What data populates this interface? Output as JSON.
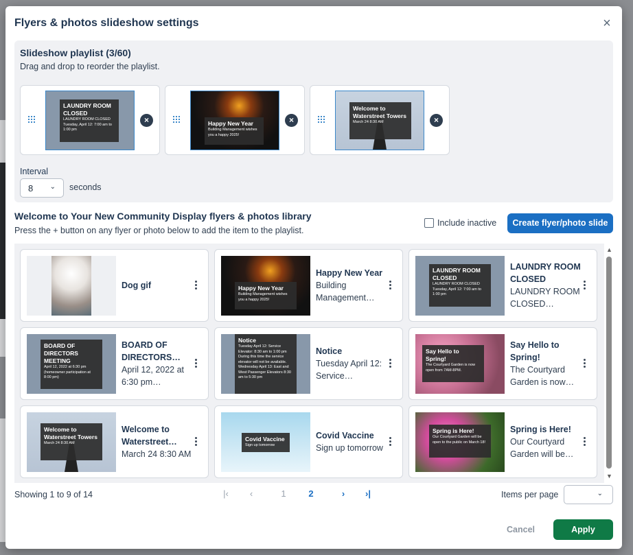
{
  "modal": {
    "title": "Flyers & photos slideshow settings"
  },
  "playlist": {
    "title": "Slideshow playlist (3/60)",
    "subtitle": "Drag and drop to reorder the playlist.",
    "items": [
      {
        "overlay_title": "LAUNDRY ROOM CLOSED",
        "overlay_text": "LAUNDRY ROOM CLOSED\nTuesday, April 12:\n7:00 am to 1:00 pm"
      },
      {
        "overlay_title": "Happy New Year",
        "overlay_text": "Building Management wishes you a happy 2025!"
      },
      {
        "overlay_title": "Welcome to Waterstreet Towers",
        "overlay_text": "March 24 8:30 AM"
      }
    ],
    "remove_icon": "×"
  },
  "interval": {
    "label": "Interval",
    "value": "8",
    "unit": "seconds"
  },
  "library": {
    "title": "Welcome to Your New Community Display flyers & photos library",
    "subtitle": "Press the + button on any flyer or photo below to add the item to the playlist.",
    "include_inactive": "Include inactive",
    "create_button": "Create flyer/photo slide"
  },
  "cards": [
    {
      "title": "Dog gif",
      "desc": "",
      "overlay_title": "",
      "overlay_text": ""
    },
    {
      "title": "Happy New Year",
      "desc": "Building Management…",
      "overlay_title": "Happy New Year",
      "overlay_text": "Building Management wishes you a happy 2025!"
    },
    {
      "title": "LAUNDRY ROOM CLOSED",
      "desc": "LAUNDRY ROOM CLOSED…",
      "overlay_title": "LAUNDRY ROOM CLOSED",
      "overlay_text": "LAUNDRY ROOM CLOSED\nTuesday, April 12:\n7:00 am to 1:00 pm"
    },
    {
      "title": "BOARD OF DIRECTORS…",
      "desc": "April 12, 2022 at 6:30 pm…",
      "overlay_title": "BOARD OF DIRECTORS MEETING",
      "overlay_text": "April 12, 2022 at 6:30 pm (homeowner participation at 8:00 pm)"
    },
    {
      "title": "Notice",
      "desc": "Tuesday April 12: Service…",
      "overlay_title": "Notice",
      "overlay_text": "Tuesday April 12: Service Elevator: 8:30 am to 1:00 pm During this time the service elevator will not be available. Wednesday April 13: East and West Passenger Elevators 8:30 am to 5:30 pm"
    },
    {
      "title": "Say Hello to Spring!",
      "desc": "The Courtyard Garden is now…",
      "overlay_title": "Say Hello to Spring!",
      "overlay_text": "The Courtyard Garden is now open from 7AM-8PM."
    },
    {
      "title": "Welcome to Waterstreet…",
      "desc": "March 24 8:30 AM",
      "overlay_title": "Welcome to Waterstreet Towers",
      "overlay_text": "March 24 8:30 AM"
    },
    {
      "title": "Covid Vaccine",
      "desc": "Sign up tomorrow",
      "overlay_title": "Covid Vaccine",
      "overlay_text": "Sign up tomorrow"
    },
    {
      "title": "Spring is Here!",
      "desc": "Our Courtyard Garden will be…",
      "overlay_title": "Spring is Here!",
      "overlay_text": "Our Courtyard Garden will be open to the public on March 18!"
    }
  ],
  "pagination": {
    "showing": "Showing 1 to 9 of 14",
    "first": "|‹",
    "prev": "‹",
    "page1": "1",
    "page2": "2",
    "next": "›",
    "last": "›|",
    "items_per_page_label": "Items per page",
    "items_per_page_value": ""
  },
  "footer": {
    "cancel": "Cancel",
    "apply": "Apply"
  },
  "colors": {
    "primary": "#1b6fc3",
    "apply": "#0f7a46",
    "panel": "#f0f1f4",
    "heading": "#1f3550"
  }
}
